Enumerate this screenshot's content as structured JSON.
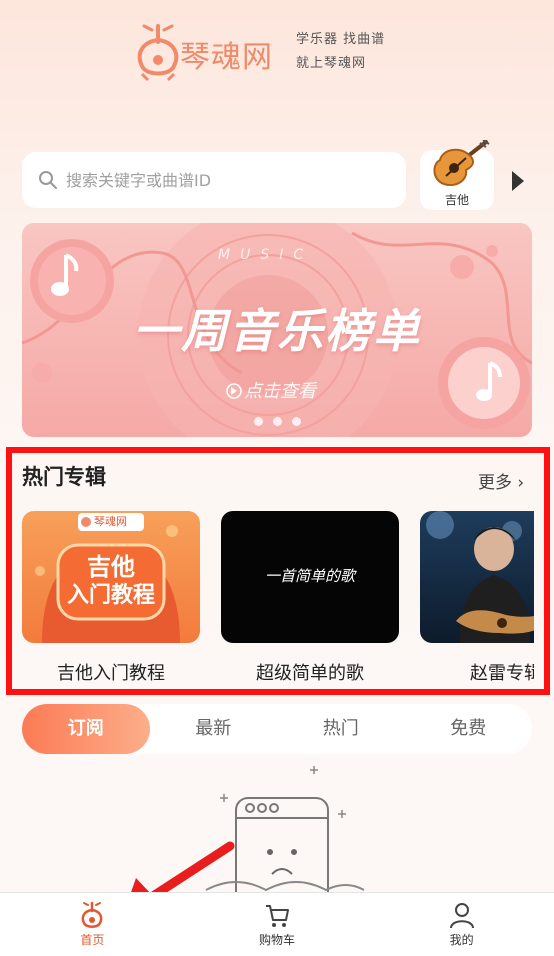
{
  "brand": {
    "name": "琴魂网",
    "slogan_line1": "学乐器 找曲谱",
    "slogan_line2": "就上琴魂网"
  },
  "search": {
    "placeholder": "搜索关键字或曲谱ID"
  },
  "instrument": {
    "label": "吉他"
  },
  "banner": {
    "title": "一周音乐榜单",
    "music_text": "MUSIC",
    "cta": "点击查看"
  },
  "hot_albums": {
    "title": "热门专辑",
    "more": "更多 ›",
    "items": [
      {
        "name": "吉他入门教程",
        "cover_badge": "琴魂网",
        "cover_text_line1": "吉他",
        "cover_text_line2": "入门教程"
      },
      {
        "name": "超级简单的歌",
        "cover_text": "一首简单的歌"
      },
      {
        "name": "赵雷专辑"
      }
    ]
  },
  "tabs": [
    "订阅",
    "最新",
    "热门",
    "免费"
  ],
  "bottom_nav": [
    {
      "label": "首页",
      "icon": "home-guitar-icon",
      "active": true
    },
    {
      "label": "购物车",
      "icon": "cart-icon",
      "active": false
    },
    {
      "label": "我的",
      "icon": "user-icon",
      "active": false
    }
  ],
  "colors": {
    "accent": "#fb7b55",
    "highlight": "#ff1111",
    "nav_active": "#e4572e"
  }
}
